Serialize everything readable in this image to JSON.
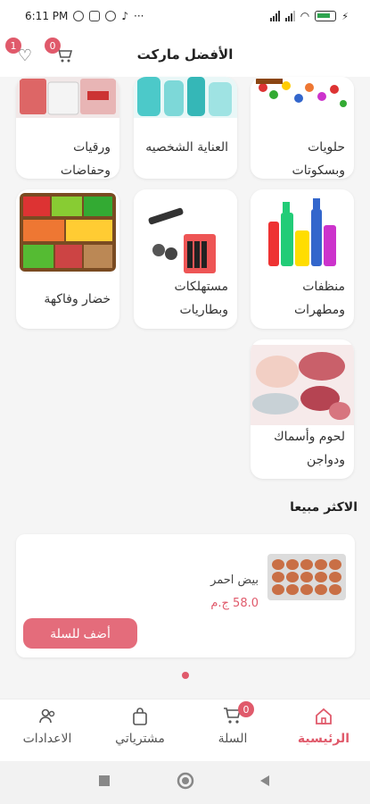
{
  "status": {
    "time": "6:11 PM",
    "more": "···"
  },
  "header": {
    "title": "الأفضل ماركت",
    "wishlist_count": "1",
    "cart_count": "0"
  },
  "categories": [
    {
      "label": "حلويات وبسكوتات"
    },
    {
      "label": "العناية الشخصيه"
    },
    {
      "label": "ورقيات وحفاضات"
    },
    {
      "label": "منظفات ومطهرات"
    },
    {
      "label": "مستهلكات وبطاريات"
    },
    {
      "label": "خضار وفاكهة"
    },
    {
      "label": "لحوم وأسماك ودواجن"
    }
  ],
  "best_sellers": {
    "title": "الاكثر مبيعا",
    "product": {
      "name": "بيض احمر",
      "price": "58.0 ج.م",
      "add_label": "أضف للسلة"
    }
  },
  "bottom_nav": {
    "home": "الرئيسية",
    "cart": "السلة",
    "cart_count": "0",
    "purchases": "مشترياتي",
    "settings": "الاعدادات"
  },
  "colors": {
    "accent": "#e05a6b",
    "button": "#e46c7b"
  }
}
